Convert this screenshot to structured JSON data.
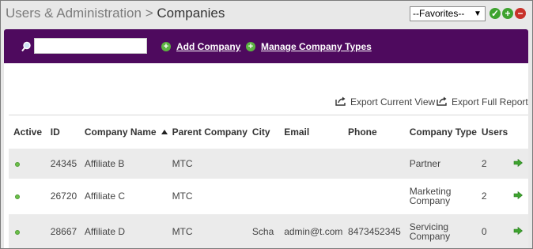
{
  "header": {
    "breadcrumb_parent": "Users & Administration",
    "breadcrumb_sep": ">",
    "title": "Companies",
    "favorites_selected": "--Favorites--",
    "ok_icon": "check-circle-icon",
    "add_icon": "plus-circle-icon",
    "remove_icon": "minus-circle-icon"
  },
  "toolbar": {
    "search_value": "",
    "add_company_label": "Add Company",
    "manage_types_label": "Manage Company Types"
  },
  "exports": {
    "current_view_label": "Export Current View",
    "full_report_label": "Export Full Report"
  },
  "colors": {
    "toolbar_bg": "#4e0a5e",
    "active_dot": "#6cc04a",
    "arrow": "#3ea32f"
  },
  "table": {
    "columns": [
      "Active",
      "ID",
      "Company Name",
      "Parent Company",
      "City",
      "Email",
      "Phone",
      "Company Type",
      "Users"
    ],
    "sorted_column": "Company Name",
    "sort_direction": "ascending",
    "rows": [
      {
        "active": true,
        "id": "24345",
        "name": "Affiliate B",
        "parent": "MTC",
        "city": "",
        "email": "",
        "phone": "",
        "type": "Partner",
        "users": "2"
      },
      {
        "active": true,
        "id": "26720",
        "name": "Affiliate C",
        "parent": "MTC",
        "city": "",
        "email": "",
        "phone": "",
        "type": "Marketing Company",
        "users": "2"
      },
      {
        "active": true,
        "id": "28667",
        "name": "Affiliate D",
        "parent": "MTC",
        "city": "Scha",
        "email": "admin@t.com",
        "phone": "8473452345",
        "type": "Servicing Company",
        "users": "0"
      }
    ]
  }
}
